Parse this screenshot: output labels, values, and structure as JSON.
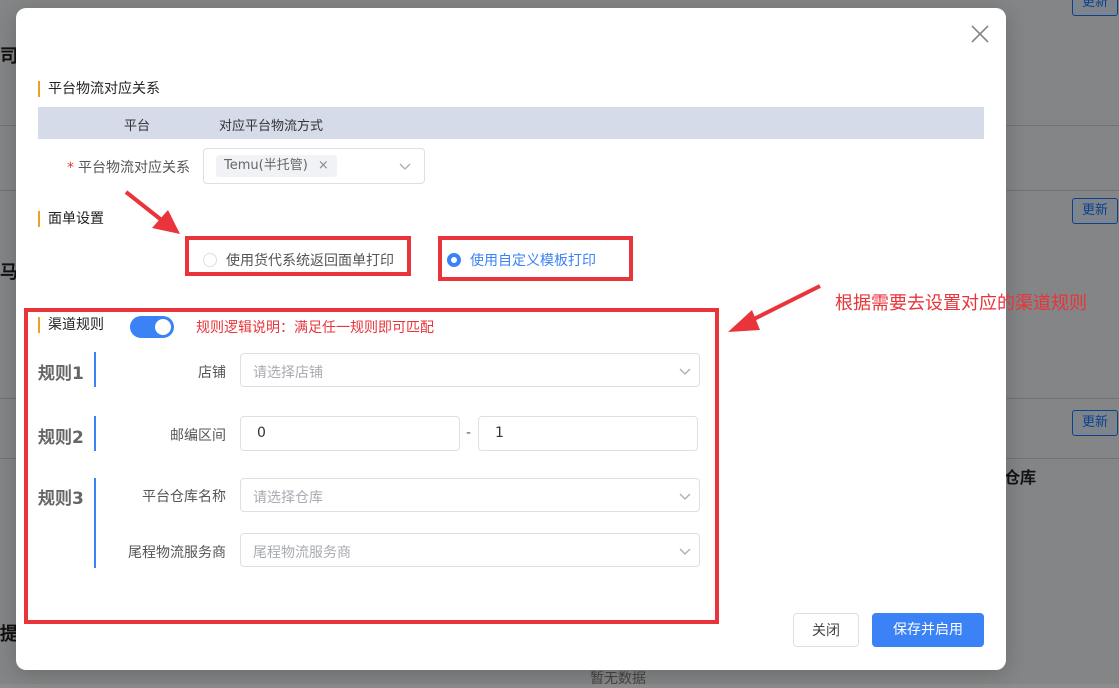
{
  "background": {
    "fragments": [
      "司公",
      "马",
      "仓库",
      "提区"
    ],
    "update_buttons": [
      "更新",
      "更新",
      "更新"
    ],
    "empty_text": "暂无数据"
  },
  "modal": {
    "section_mapping": {
      "title": "平台物流对应关系",
      "table_headers": [
        "平台",
        "对应平台物流方式"
      ],
      "field_label": "平台物流对应关系",
      "required_mark": "*",
      "selected_tag": "Temu(半托管)",
      "tag_remove": "×"
    },
    "section_label": {
      "title": "面单设置",
      "options": [
        {
          "label": "使用货代系统返回面单打印",
          "selected": false
        },
        {
          "label": "使用自定义模板打印",
          "selected": true
        }
      ]
    },
    "section_channel": {
      "title": "渠道规则",
      "toggle_on": true,
      "hint": "规则逻辑说明：满足任一规则即可匹配",
      "rules": [
        {
          "name": "规则1",
          "fields": [
            {
              "label": "店铺",
              "placeholder": "请选择店铺"
            }
          ]
        },
        {
          "name": "规则2",
          "fields": [
            {
              "label": "邮编区间",
              "from": "0",
              "separator": "-",
              "to": "1"
            }
          ]
        },
        {
          "name": "规则3",
          "fields": [
            {
              "label": "平台仓库名称",
              "placeholder": "请选择仓库"
            },
            {
              "label": "尾程物流服务商",
              "placeholder": "尾程物流服务商"
            }
          ]
        }
      ]
    },
    "footer": {
      "close_label": "关闭",
      "save_label": "保存并启用"
    }
  },
  "annotation": {
    "text": "根据需要去设置对应的渠道规则"
  },
  "colors": {
    "accent": "#3b82f6",
    "annotation": "#e8343a",
    "section_mark": "#f0a020"
  }
}
